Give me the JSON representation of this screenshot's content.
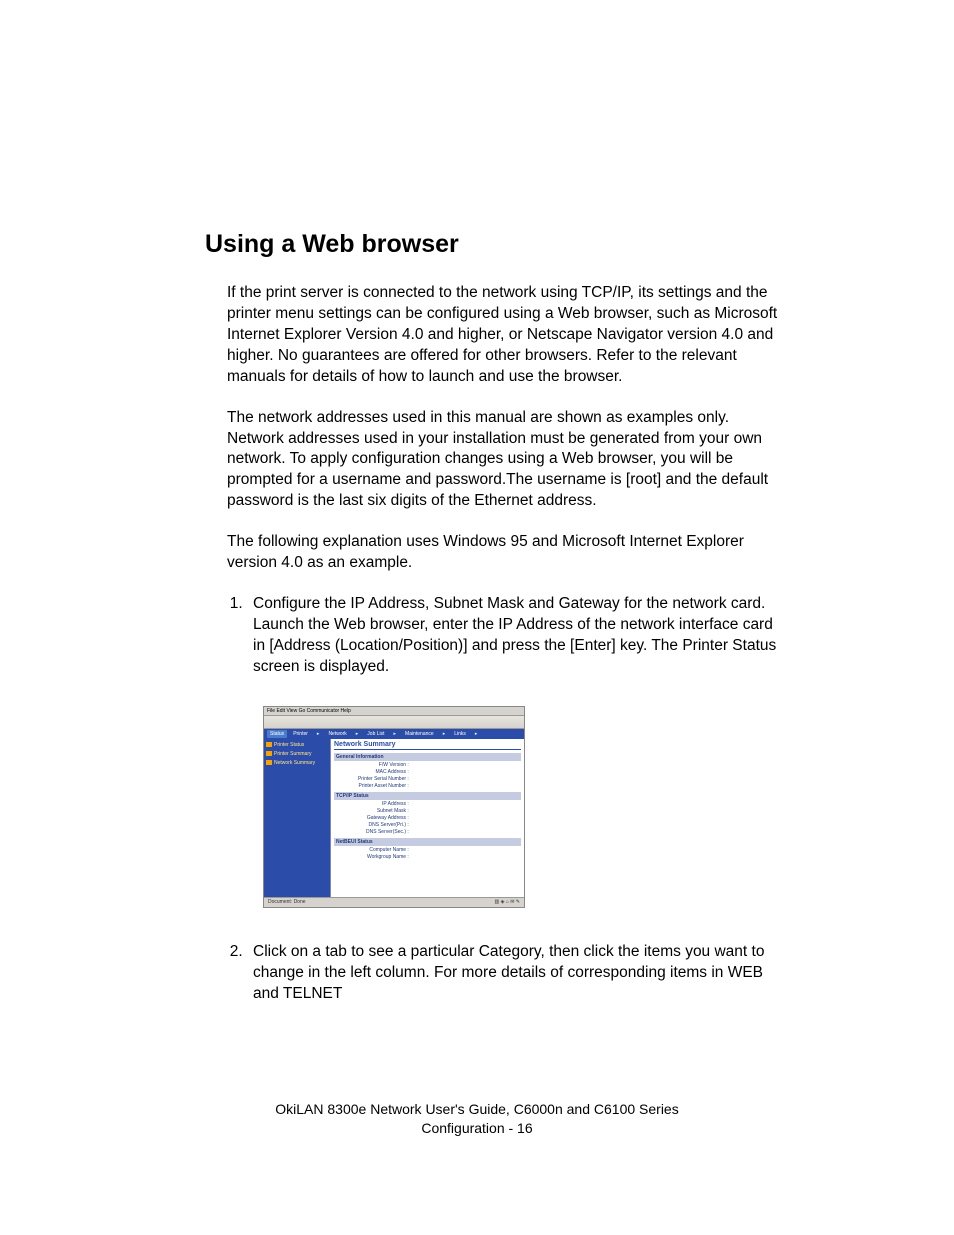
{
  "heading": "Using a Web browser",
  "paragraphs": {
    "p1": "If the print server is connected to the network using TCP/IP, its settings and the printer menu settings can be configured using a Web browser, such as Microsoft Internet Explorer Version 4.0 and higher, or Netscape Navigator version 4.0 and higher. No guarantees are offered for other browsers. Refer to the relevant manuals for details of how to launch and use the browser.",
    "p2": "The network addresses used in this manual are shown as examples only. Network addresses used in your installation must be generated from your own network. To apply configuration changes using a Web browser, you will be prompted for a username and password.The username is [root] and the default password is the last six digits of the Ethernet address.",
    "p3": "The following explanation uses Windows 95 and Microsoft Internet Explorer version 4.0 as an example."
  },
  "steps": {
    "s1": "Configure the IP Address, Subnet Mask and Gateway for the network card. Launch the Web browser, enter the IP Address of the network interface card in [Address (Location/Position)] and press the [Enter] key. The Printer Status screen is displayed.",
    "s2": "Click on a tab to see a particular Category, then click the items you want to change in the left column. For more details of corresponding items in WEB and TELNET"
  },
  "screenshot": {
    "menubar": "File  Edit  View  Go  Communicator  Help",
    "tabs": [
      "Status",
      "Printer",
      "Network",
      "Job List",
      "Maintenance",
      "Links"
    ],
    "sidebar": [
      "Printer Status",
      "Printer Summary",
      "Network Summary"
    ],
    "main_heading": "Network Summary",
    "sections": {
      "general": {
        "label": "General Information",
        "rows": [
          "F/W Version :",
          "MAC Address :",
          "Printer Serial Number :",
          "Printer Asset Number :"
        ]
      },
      "tcpip": {
        "label": "TCP/IP Status",
        "rows": [
          "IP Address :",
          "Subnet Mask :",
          "Gateway Address :",
          "DNS Server(Pri.) :",
          "DNS Server(Sec.) :"
        ]
      },
      "netbeui": {
        "label": "NetBEUI Status",
        "rows": [
          "Computer Name :",
          "Workgroup Name :"
        ]
      }
    },
    "statusbar_left": "Document: Done"
  },
  "footer": {
    "line1": "OkiLAN 8300e Network User's Guide, C6000n and C6100 Series",
    "line2": "Configuration   -   16"
  }
}
